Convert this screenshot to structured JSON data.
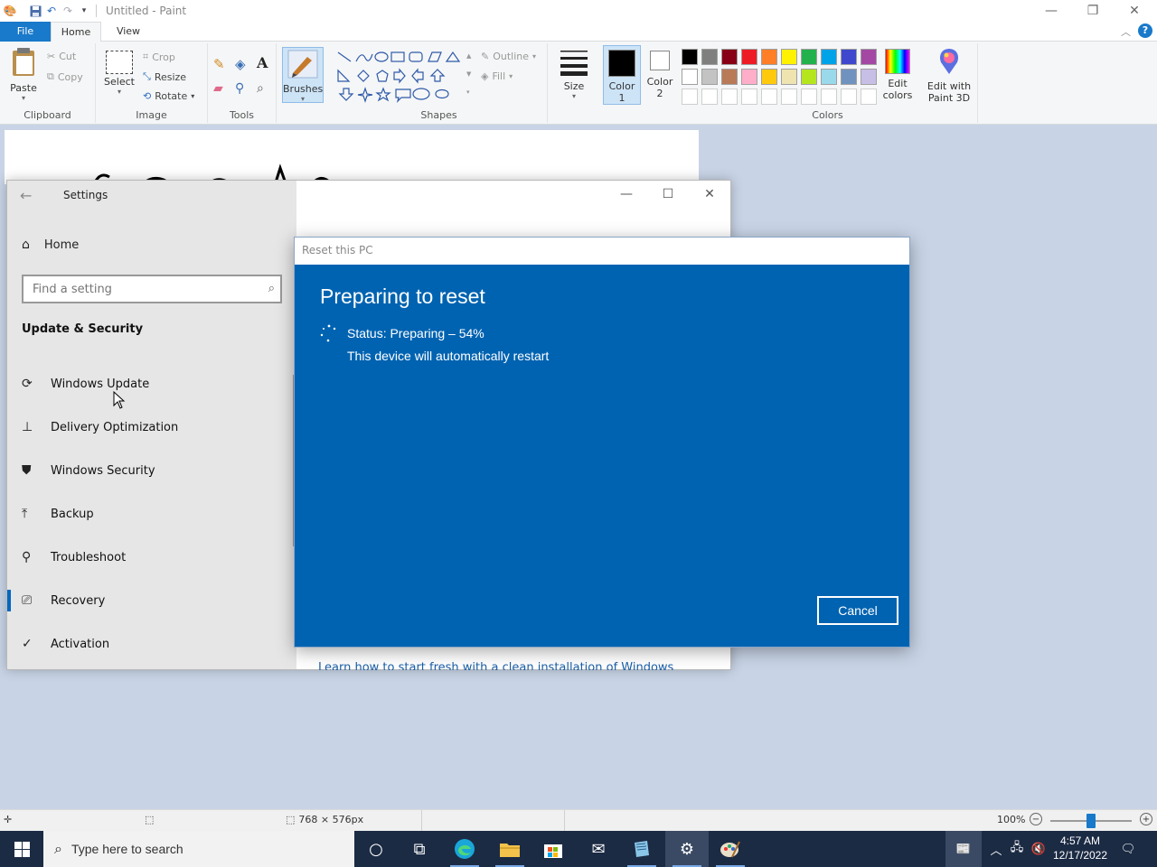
{
  "paint": {
    "title": "Untitled - Paint",
    "tabs": {
      "file": "File",
      "home": "Home",
      "view": "View"
    },
    "clipboard": {
      "paste": "Paste",
      "cut": "Cut",
      "copy": "Copy",
      "label": "Clipboard"
    },
    "image": {
      "select": "Select",
      "crop": "Crop",
      "resize": "Resize",
      "rotate": "Rotate",
      "label": "Image"
    },
    "tools": {
      "label": "Tools"
    },
    "brushes": "Brushes",
    "shapes": {
      "outline": "Outline",
      "fill": "Fill",
      "label": "Shapes"
    },
    "size": "Size",
    "color1": {
      "line1": "Color",
      "line2": "1"
    },
    "color2": {
      "line1": "Color",
      "line2": "2"
    },
    "colors_label": "Colors",
    "edit_colors": {
      "line1": "Edit",
      "line2": "colors"
    },
    "paint3d": {
      "line1": "Edit with",
      "line2": "Paint 3D"
    },
    "palette_row1": [
      "#000000",
      "#7f7f7f",
      "#880015",
      "#ed1c24",
      "#ff7f27",
      "#fff200",
      "#22b14c",
      "#00a2e8",
      "#3f48cc",
      "#a349a4"
    ],
    "palette_row2": [
      "#ffffff",
      "#c3c3c3",
      "#b97a57",
      "#ffaec9",
      "#ffc90e",
      "#efe4b0",
      "#b5e61d",
      "#99d9ea",
      "#7092be",
      "#c8bfe7"
    ],
    "status": {
      "size": "768 × 576px",
      "zoom": "100%",
      "zoom_level": 0.5
    }
  },
  "settings": {
    "title": "Settings",
    "home": "Home",
    "search_placeholder": "Find a setting",
    "section": "Update & Security",
    "nav": [
      {
        "label": "Windows Update",
        "icon": "sync-icon"
      },
      {
        "label": "Delivery Optimization",
        "icon": "delivery-icon"
      },
      {
        "label": "Windows Security",
        "icon": "shield-icon"
      },
      {
        "label": "Backup",
        "icon": "backup-icon"
      },
      {
        "label": "Troubleshoot",
        "icon": "wrench-icon"
      },
      {
        "label": "Recovery",
        "icon": "recovery-icon"
      },
      {
        "label": "Activation",
        "icon": "check-circle-icon"
      }
    ],
    "link": "Learn how to start fresh with a clean installation of Windows"
  },
  "reset_dialog": {
    "title": "Reset this PC",
    "heading": "Preparing to reset",
    "status": "Status: Preparing – 54%",
    "progress_percent": 54,
    "restart_note": "This device will automatically restart",
    "cancel": "Cancel"
  },
  "taskbar": {
    "search_placeholder": "Type here to search",
    "time": "4:57 AM",
    "date": "12/17/2022"
  },
  "colors": {
    "dialog_blue": "#0063b1",
    "accent": "#0067c0",
    "taskbar": "#1c2b44"
  }
}
